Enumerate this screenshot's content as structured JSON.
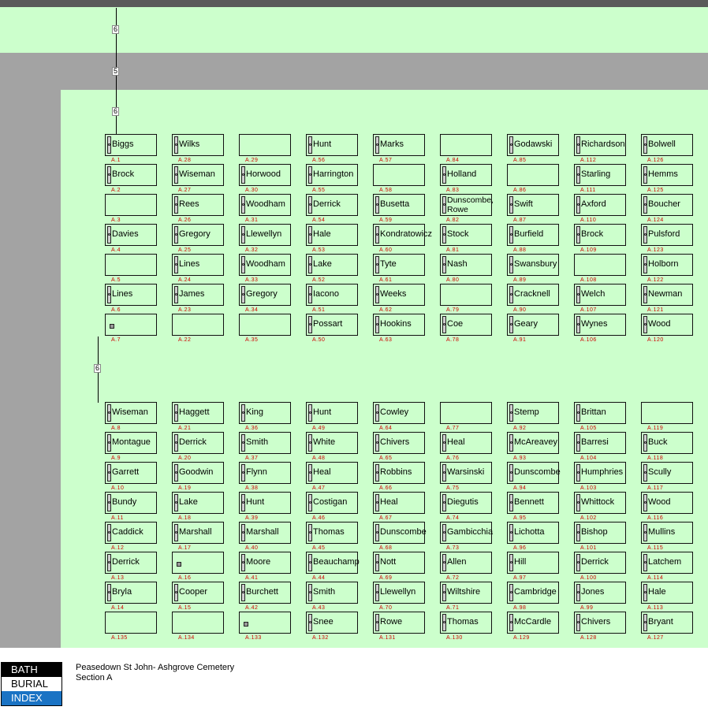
{
  "logo": {
    "line1": "BATH",
    "line2": "BURIAL",
    "line3": "INDEX"
  },
  "title": {
    "cemetery": "Peasedown St John- Ashgrove Cemetery",
    "section": "Section A"
  },
  "colors": {
    "grass": "#ccffcc",
    "path": "#a3a3a3",
    "border": "#5a5a5a",
    "code": "#d00000"
  },
  "dimensions": [
    "6",
    "5",
    "6",
    "6"
  ],
  "columns": [
    {
      "top": [
        [
          "Biggs",
          "A.1"
        ],
        [
          "Brock",
          "A.2"
        ],
        [
          "",
          "A.3"
        ],
        [
          "Davies",
          "A.4"
        ],
        [
          "",
          "A.5"
        ],
        [
          "Lines",
          "A.6"
        ],
        [
          "",
          "A.7"
        ]
      ],
      "bottom": [
        [
          "Wiseman",
          "A.8"
        ],
        [
          "Montague",
          "A.9"
        ],
        [
          "Garrett",
          "A.10"
        ],
        [
          "Bundy",
          "A.11"
        ],
        [
          "Caddick",
          "A.12"
        ],
        [
          "Derrick",
          "A.13"
        ],
        [
          "Bryla",
          "A.14"
        ],
        [
          "",
          "A.135"
        ]
      ]
    },
    {
      "top": [
        [
          "Wilks",
          "A.28"
        ],
        [
          "Wiseman",
          "A.27"
        ],
        [
          "Rees",
          "A.26"
        ],
        [
          "Gregory",
          "A.25"
        ],
        [
          "Lines",
          "A.24"
        ],
        [
          "James",
          "A.23"
        ],
        [
          "",
          "A.22"
        ]
      ],
      "bottom": [
        [
          "Haggett",
          "A.21"
        ],
        [
          "Derrick",
          "A.20"
        ],
        [
          "Goodwin",
          "A.19"
        ],
        [
          "Lake",
          "A.18"
        ],
        [
          "Marshall",
          "A.17"
        ],
        [
          "",
          "A.16"
        ],
        [
          "Cooper",
          "A.15"
        ],
        [
          "",
          "A.134"
        ]
      ]
    },
    {
      "top": [
        [
          "",
          "A.29"
        ],
        [
          "Horwood",
          "A.30"
        ],
        [
          "Woodham",
          "A.31"
        ],
        [
          "Llewellyn",
          "A.32"
        ],
        [
          "Woodham",
          "A.33"
        ],
        [
          "Gregory",
          "A.34"
        ],
        [
          "",
          "A.35"
        ]
      ],
      "bottom": [
        [
          "King",
          "A.36"
        ],
        [
          "Smith",
          "A.37"
        ],
        [
          "Flynn",
          "A.38"
        ],
        [
          "Hunt",
          "A.39"
        ],
        [
          "Marshall",
          "A.40"
        ],
        [
          "Moore",
          "A.41"
        ],
        [
          "Burchett",
          "A.42"
        ],
        [
          "",
          "A.133"
        ]
      ]
    },
    {
      "top": [
        [
          "Hunt",
          "A.56"
        ],
        [
          "Harrington",
          "A.55"
        ],
        [
          "Derrick",
          "A.54"
        ],
        [
          "Hale",
          "A.53"
        ],
        [
          "Lake",
          "A.52"
        ],
        [
          "Iacono",
          "A.51"
        ],
        [
          "Possart",
          "A.50"
        ]
      ],
      "bottom": [
        [
          "Hunt",
          "A.49"
        ],
        [
          "White",
          "A.48"
        ],
        [
          "Heal",
          "A.47"
        ],
        [
          "Costigan",
          "A.46"
        ],
        [
          "Thomas",
          "A.45"
        ],
        [
          "Beauchamp",
          "A.44"
        ],
        [
          "Smith",
          "A.43"
        ],
        [
          "Snee",
          "A.132"
        ]
      ]
    },
    {
      "top": [
        [
          "Marks",
          "A.57"
        ],
        [
          "",
          "A.58"
        ],
        [
          "Busetta",
          "A.59"
        ],
        [
          "Kondratowicz",
          "A.60"
        ],
        [
          "Tyte",
          "A.61"
        ],
        [
          "Weeks",
          "A.62"
        ],
        [
          "Hookins",
          "A.63"
        ]
      ],
      "bottom": [
        [
          "Cowley",
          "A.64"
        ],
        [
          "Chivers",
          "A.65"
        ],
        [
          "Robbins",
          "A.66"
        ],
        [
          "Heal",
          "A.67"
        ],
        [
          "Dunscombe",
          "A.68"
        ],
        [
          "Nott",
          "A.69"
        ],
        [
          "Llewellyn",
          "A.70"
        ],
        [
          "Rowe",
          "A.131"
        ]
      ]
    },
    {
      "top": [
        [
          "",
          "A.84"
        ],
        [
          "Holland",
          "A.83"
        ],
        [
          "Dunscombe, Rowe",
          "A.82"
        ],
        [
          "Stock",
          "A.81"
        ],
        [
          "Nash",
          "A.80"
        ],
        [
          "",
          "A.79"
        ],
        [
          "Coe",
          "A.78"
        ]
      ],
      "bottom": [
        [
          "",
          "A.77"
        ],
        [
          "Heal",
          "A.76"
        ],
        [
          "Warsinski",
          "A.75"
        ],
        [
          "Diegutis",
          "A.74"
        ],
        [
          "Gambicchia",
          "A.73"
        ],
        [
          "Allen",
          "A.72"
        ],
        [
          "Wiltshire",
          "A.71"
        ],
        [
          "Thomas",
          "A.130"
        ]
      ]
    },
    {
      "top": [
        [
          "Godawski",
          "A.85"
        ],
        [
          "",
          "A.86"
        ],
        [
          "Swift",
          "A.87"
        ],
        [
          "Burfield",
          "A.88"
        ],
        [
          "Swansbury",
          "A.89"
        ],
        [
          "Cracknell",
          "A.90"
        ],
        [
          "Geary",
          "A.91"
        ]
      ],
      "bottom": [
        [
          "Stemp",
          "A.92"
        ],
        [
          "McAreavey",
          "A.93"
        ],
        [
          "Dunscombe",
          "A.94"
        ],
        [
          "Bennett",
          "A.95"
        ],
        [
          "Lichotta",
          "A.96"
        ],
        [
          "Hill",
          "A.97"
        ],
        [
          "Cambridge",
          "A.98"
        ],
        [
          "McCardle",
          "A.129"
        ]
      ]
    },
    {
      "top": [
        [
          "Richardson",
          "A.112"
        ],
        [
          "Starling",
          "A.111"
        ],
        [
          "Axford",
          "A.110"
        ],
        [
          "Brock",
          "A.109"
        ],
        [
          "",
          "A.108"
        ],
        [
          "Welch",
          "A.107"
        ],
        [
          "Wynes",
          "A.106"
        ]
      ],
      "bottom": [
        [
          "Brittan",
          "A.105"
        ],
        [
          "Barresi",
          "A.104"
        ],
        [
          "Humphries",
          "A.103"
        ],
        [
          "Whittock",
          "A.102"
        ],
        [
          "Bishop",
          "A.101"
        ],
        [
          "Derrick",
          "A.100"
        ],
        [
          "Jones",
          "A.99"
        ],
        [
          "Chivers",
          "A.128"
        ]
      ]
    },
    {
      "top": [
        [
          "Bolwell",
          "A.126"
        ],
        [
          "Hemms",
          "A.125"
        ],
        [
          "Boucher",
          "A.124"
        ],
        [
          "Pulsford",
          "A.123"
        ],
        [
          "Holborn",
          "A.122"
        ],
        [
          "Newman",
          "A.121"
        ],
        [
          "Wood",
          "A.120"
        ]
      ],
      "bottom": [
        [
          "",
          "A.119"
        ],
        [
          "Buck",
          "A.118"
        ],
        [
          "Scully",
          "A.117"
        ],
        [
          "Wood",
          "A.116"
        ],
        [
          "Mullins",
          "A.115"
        ],
        [
          "Latchem",
          "A.114"
        ],
        [
          "Hale",
          "A.113"
        ],
        [
          "Bryant",
          "A.127"
        ]
      ]
    }
  ]
}
